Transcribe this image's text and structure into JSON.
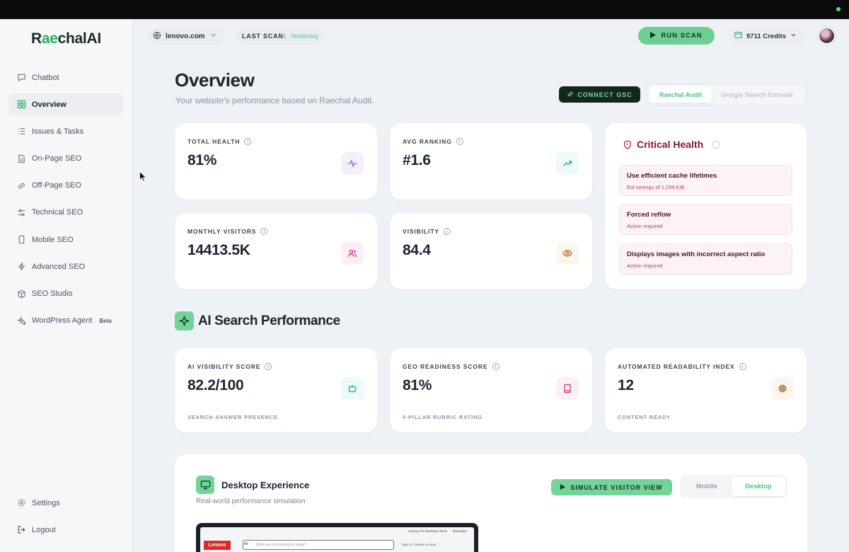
{
  "brand": {
    "name_start": "R",
    "name_mid": "ae",
    "name_end": "chal",
    "name_ai": "AI"
  },
  "sidebar": {
    "items": [
      {
        "label": "Chatbot",
        "icon": "chat-icon"
      },
      {
        "label": "Overview",
        "icon": "grid-icon",
        "active": true
      },
      {
        "label": "Issues & Tasks",
        "icon": "list-icon"
      },
      {
        "label": "On-Page SEO",
        "icon": "file-icon"
      },
      {
        "label": "Off-Page SEO",
        "icon": "link-icon"
      },
      {
        "label": "Technical SEO",
        "icon": "sliders-icon"
      },
      {
        "label": "Mobile SEO",
        "icon": "phone-icon"
      },
      {
        "label": "Advanced SEO",
        "icon": "bolt-icon"
      },
      {
        "label": "SEO Studio",
        "icon": "cube-icon"
      },
      {
        "label": "WordPress Agent",
        "icon": "sparkle-icon",
        "badge": "Beta"
      }
    ],
    "settings_label": "Settings",
    "logout_label": "Logout"
  },
  "header": {
    "domain": "lenovo.com",
    "last_scan_label": "LAST SCAN:",
    "last_scan_value": "Yesterday",
    "run_scan_label": "RUN SCAN",
    "credits": "9711 Credits"
  },
  "overview": {
    "title": "Overview",
    "subtitle": "Your website's performance based on Raechal Audit.",
    "connect_gsc": "CONNECT GSC",
    "tabs": [
      "Raechal Audit",
      "Google Search Console"
    ]
  },
  "metrics": [
    {
      "label": "TOTAL HEALTH",
      "value": "81%",
      "icon": "pulse-icon",
      "accent": "#8b5cf6"
    },
    {
      "label": "AVG RANKING",
      "value": "#1.6",
      "icon": "trending-up-icon",
      "accent": "#0ea5a4"
    },
    {
      "label": "MONTHLY VISITORS",
      "value": "14413.5K",
      "icon": "users-icon",
      "accent": "#db2777"
    },
    {
      "label": "VISIBILITY",
      "value": "84.4",
      "icon": "eye-icon",
      "accent": "#b45309"
    }
  ],
  "critical": {
    "title": "Critical Health",
    "items": [
      {
        "title": "Use efficient cache lifetimes",
        "sub": "Est savings of 1,249 KiB"
      },
      {
        "title": "Forced reflow",
        "sub": "Action required"
      },
      {
        "title": "Displays images with incorrect aspect ratio",
        "sub": "Action required"
      }
    ]
  },
  "ai_section": {
    "title": "AI Search Performance",
    "cards": [
      {
        "label": "AI VISIBILITY SCORE",
        "value": "82.2/100",
        "foot": "SEARCH ANSWER PRESENCE",
        "icon": "robot-icon"
      },
      {
        "label": "GEO READINESS SCORE",
        "value": "81%",
        "foot": "5-PILLAR RUBRIC RATING",
        "icon": "book-icon"
      },
      {
        "label": "AUTOMATED READABILITY INDEX",
        "value": "12",
        "foot": "CONTENT READY",
        "icon": "cpu-icon"
      }
    ]
  },
  "desktop": {
    "title": "Desktop Experience",
    "subtitle": "Real-world performance simulation",
    "simulate_label": "SIMULATE VISITOR VIEW",
    "tabs": [
      "Mobile",
      "Desktop"
    ],
    "preview": {
      "logo": "Lenovo",
      "search_placeholder": "What are you looking for today?",
      "search_scope": "All",
      "links": [
        "Lenovo Pro Business Store",
        "Education"
      ],
      "sign_in": "Sign In / Create Account"
    }
  },
  "colors": {
    "accent_green": "#72d499",
    "critical_red": "#8a1632",
    "sidebar_bg": "#f6f7f9",
    "page_bg": "#eef1f5"
  }
}
